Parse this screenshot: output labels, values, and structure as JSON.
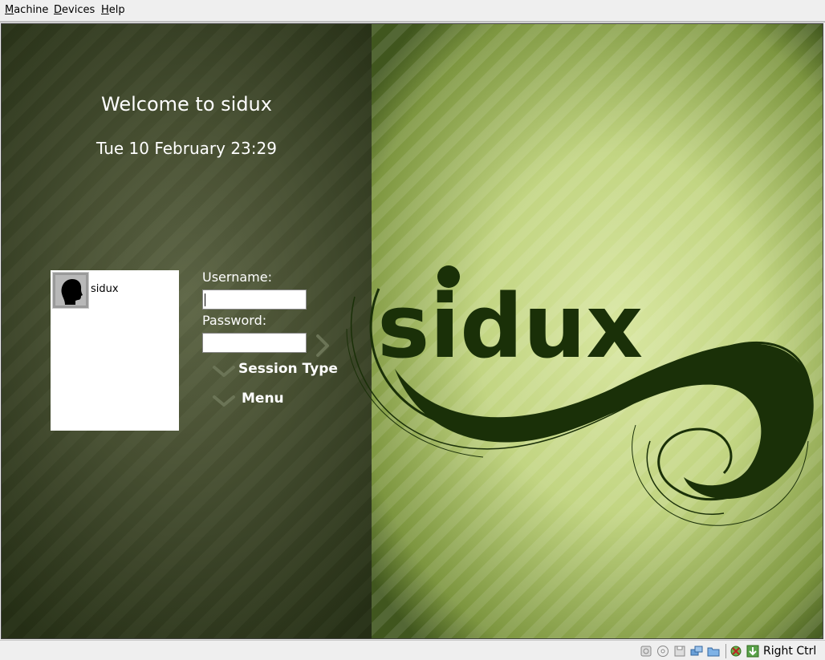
{
  "menubar": {
    "items": [
      {
        "label": "Machine",
        "underline": "M",
        "rest": "achine"
      },
      {
        "label": "Devices",
        "underline": "D",
        "rest": "evices"
      },
      {
        "label": "Help",
        "underline": "H",
        "rest": "elp"
      }
    ]
  },
  "greeter": {
    "welcome": "Welcome to sidux",
    "datetime": "Tue 10 February 23:29",
    "users": [
      {
        "name": "sidux",
        "icon": "user-silhouette-icon"
      }
    ],
    "username_label": "Username:",
    "username_value": "",
    "password_label": "Password:",
    "password_value": "",
    "session_type_label": "Session Type",
    "menu_label": "Menu",
    "logo_text": "sidux"
  },
  "statusbar": {
    "icons": [
      "hard-disk-icon",
      "cd-icon",
      "floppy-icon",
      "network-icon",
      "shared-folder-icon",
      "mouse-integration-icon",
      "vrdp-icon"
    ],
    "host_key": "Right Ctrl"
  },
  "colors": {
    "left_panel": "#3a4428",
    "right_panel": "#c2d582",
    "logo": "#1a3008"
  }
}
